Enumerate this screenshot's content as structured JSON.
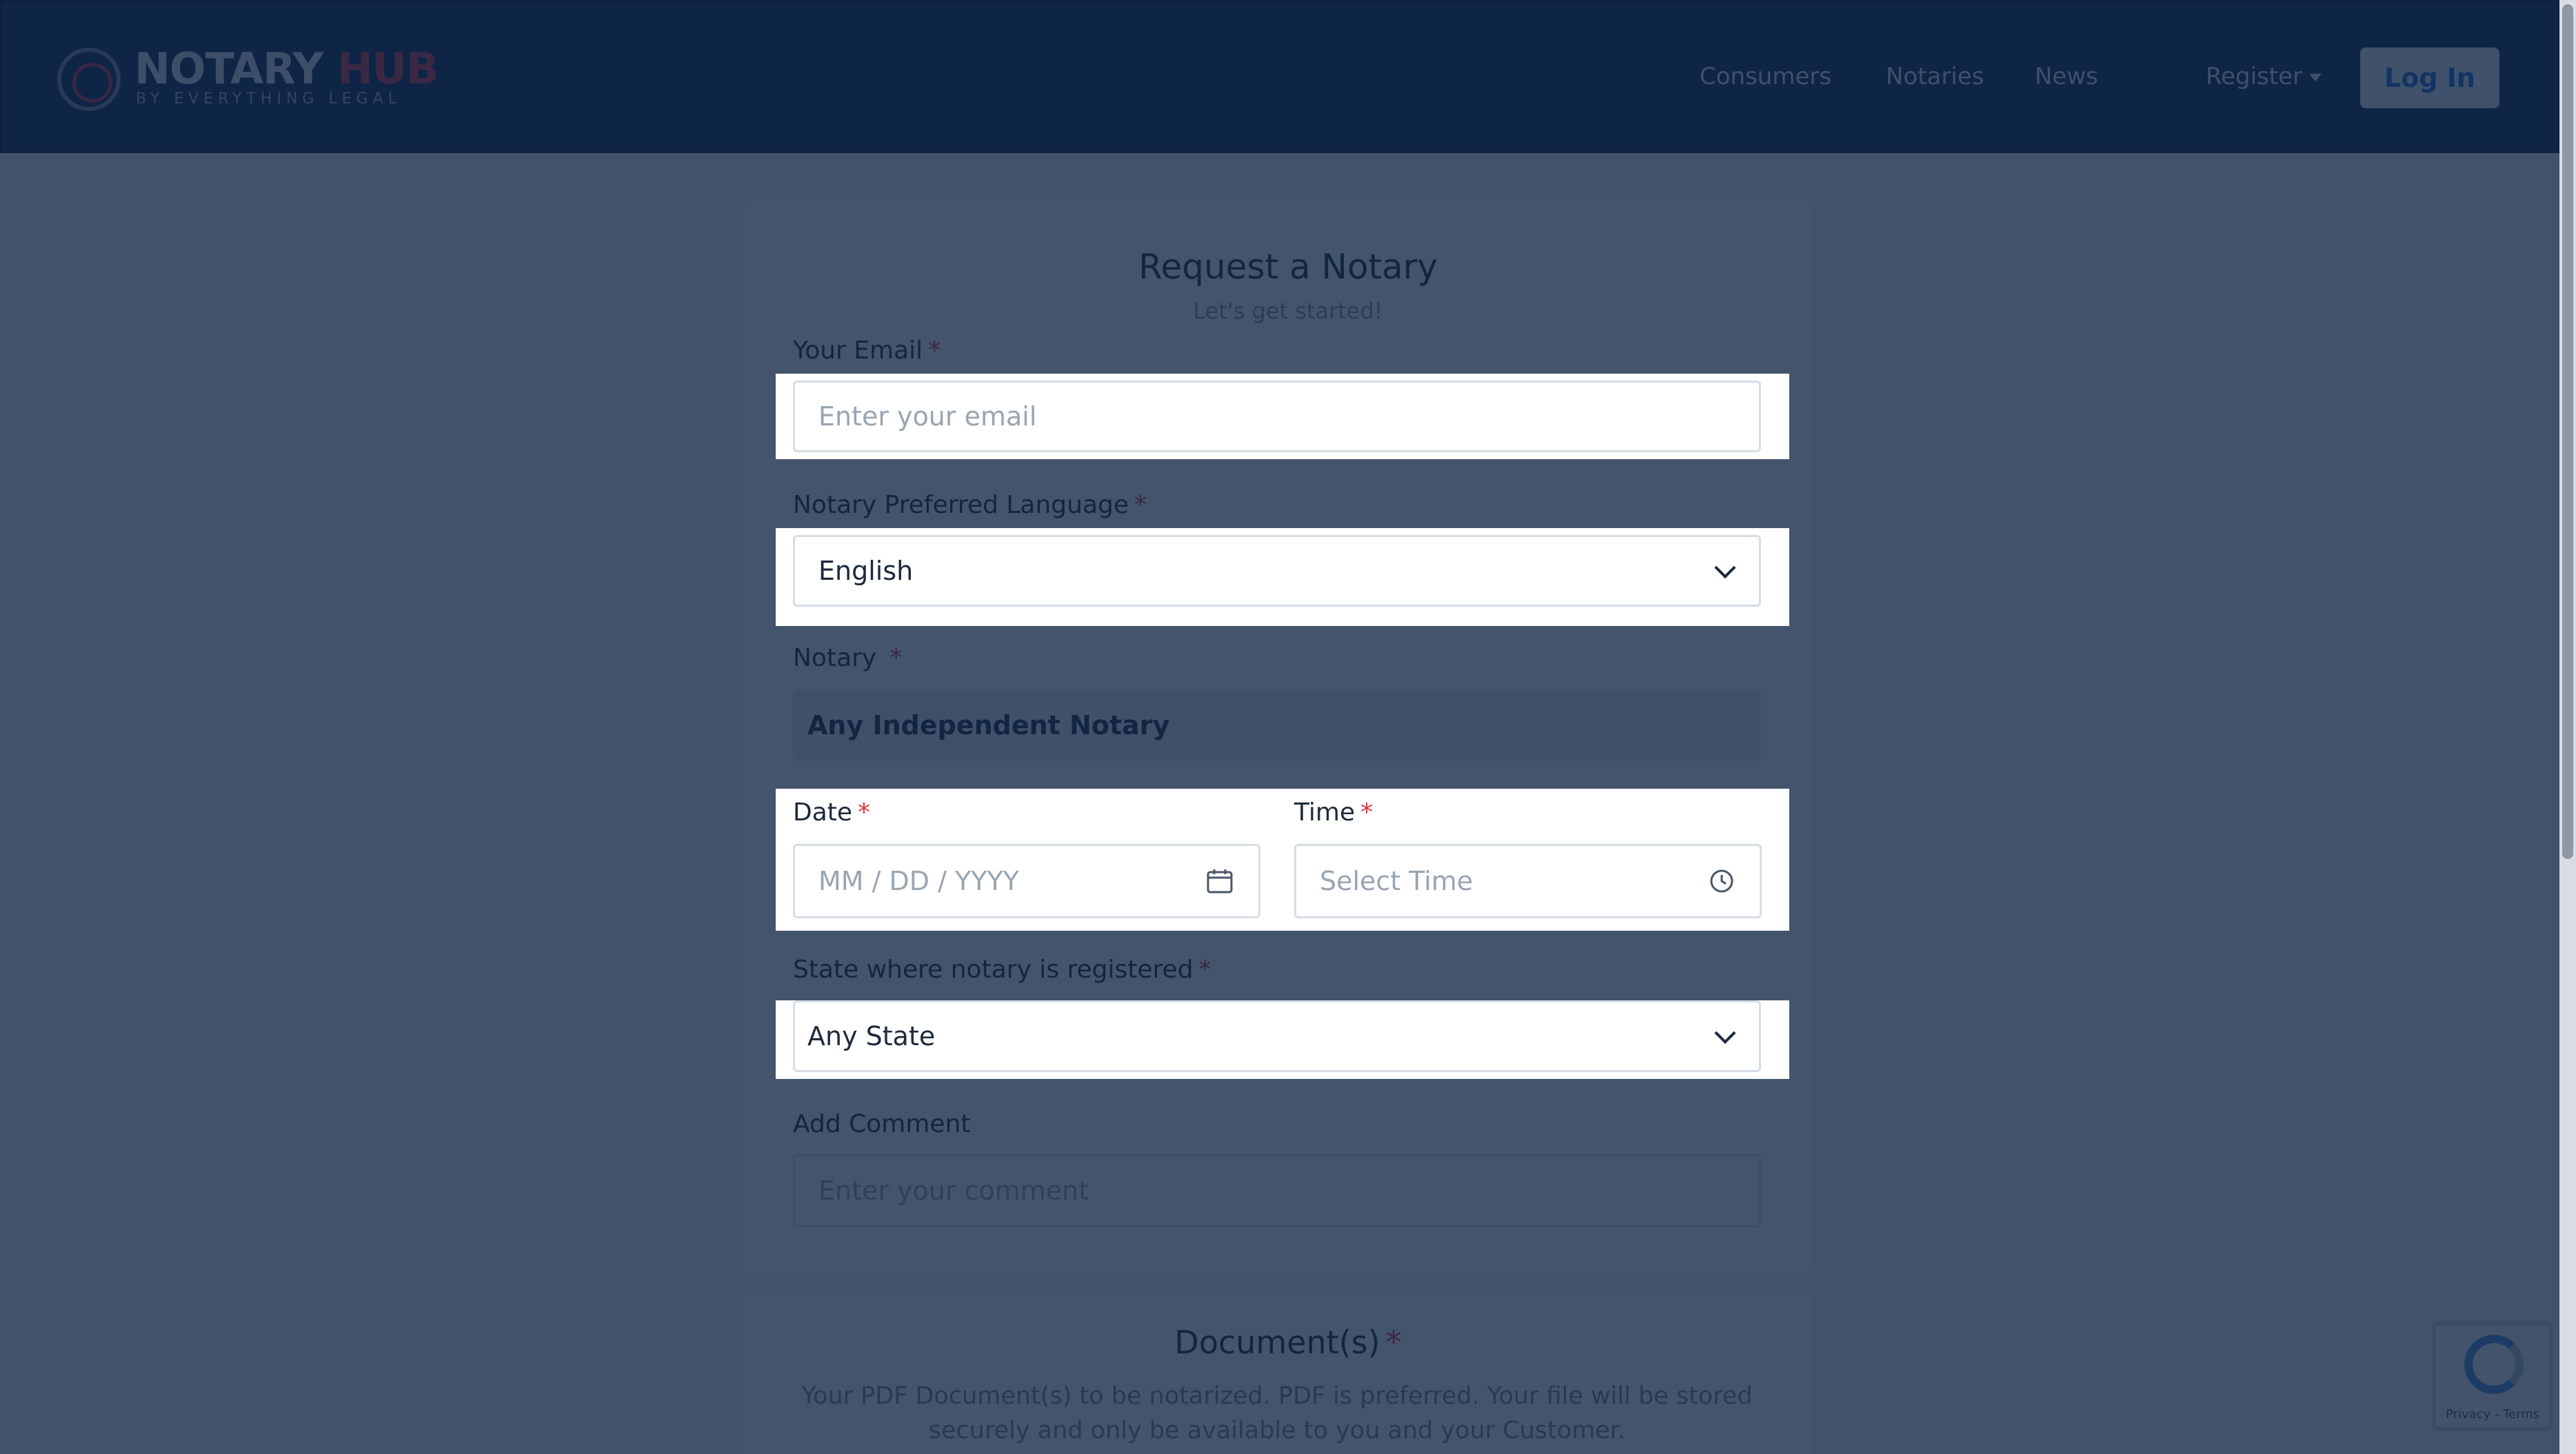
{
  "header": {
    "logo_word_main": "NOTARY",
    "logo_word_accent": "HUB",
    "logo_tagline": "BY EVERYTHING LEGAL",
    "nav": [
      "Consumers",
      "Notaries",
      "News"
    ],
    "register_label": "Register",
    "login_label": "Log In"
  },
  "form": {
    "title": "Request a Notary",
    "subtitle": "Let's get started!",
    "email": {
      "label": "Your Email",
      "required": "*",
      "placeholder": "Enter your email"
    },
    "language": {
      "label": "Notary Preferred Language",
      "required": "*",
      "value": "English"
    },
    "notary": {
      "label": "Notary",
      "required": "*",
      "value": "Any Independent Notary"
    },
    "date": {
      "label": "Date",
      "required": "*",
      "placeholder": "MM / DD / YYYY"
    },
    "time": {
      "label": "Time",
      "required": "*",
      "placeholder": "Select Time"
    },
    "state": {
      "label": "State where notary is registered",
      "required": "*",
      "value": "Any State"
    },
    "comment": {
      "label": "Add Comment",
      "placeholder": "Enter your comment"
    }
  },
  "documents": {
    "title": "Document(s)",
    "required": "*",
    "description": "Your PDF Document(s) to be notarized. PDF is preferred. Your file will be stored securely and only be available to you and your Customer."
  },
  "recaptcha": {
    "footer": "Privacy - Terms"
  },
  "icons": {
    "calendar": "calendar-icon",
    "clock": "clock-icon",
    "chevron": "chevron-down-icon"
  },
  "colors": {
    "header_bg": "#0b2a52",
    "accent_red": "#d2374f",
    "required_red": "#e03440",
    "login_text": "#1c6fd1"
  }
}
